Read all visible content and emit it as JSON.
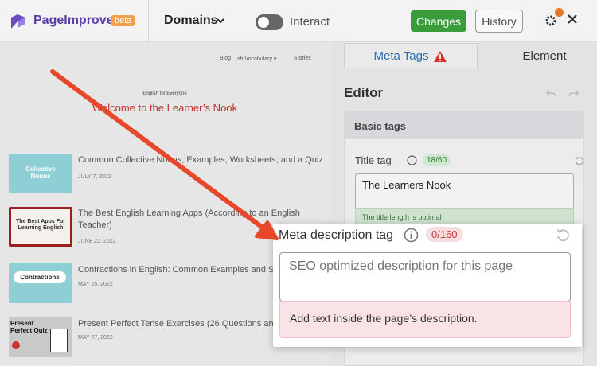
{
  "app": {
    "brand": "PageImprove",
    "beta_badge": "beta",
    "domains_label": "Domains",
    "interact_label": "Interact",
    "changes_label": "Changes",
    "history_label": "History"
  },
  "preview": {
    "nav": [
      "Blog",
      "sh Vocabulary ▾",
      "Stories"
    ],
    "kicker": "English for Everyone",
    "site_title": "Welcome to the Learner’s Nook",
    "posts": [
      {
        "title": "Common Collective Nouns, Examples, Worksheets, and a Quiz",
        "date": "JULY 7, 2022",
        "thumb_text": "Collective Nouns",
        "thumb_bg": "#8ecfd6"
      },
      {
        "title": "The Best English Learning Apps (According to an English Teacher)",
        "date": "JUNE 22, 2022",
        "thumb_text": "The Best Apps For Learning English",
        "thumb_bg": "#f4f1ec"
      },
      {
        "title": "Contractions in English: Common Examples and Sp",
        "date": "MAY 25, 2022",
        "thumb_text": "Contractions",
        "thumb_bg": "#8ecfd6"
      },
      {
        "title": "Present Perfect Tense Exercises (26 Questions and",
        "date": "MAY 27, 2022",
        "thumb_text": "Present Perfect Quiz",
        "thumb_bg": "#c9c9c9"
      }
    ]
  },
  "panel": {
    "tab_meta": "Meta Tags",
    "tab_element": "Element",
    "editor_title": "Editor",
    "basic_tags": "Basic tags",
    "title_tag_label": "Title tag",
    "title_count": "18/60",
    "title_value": "The Learners Nook",
    "title_note": "The title length is optimal"
  },
  "meta_description": {
    "label": "Meta description tag",
    "count": "0/160",
    "placeholder": "SEO optimized description for this page",
    "error": "Add text inside the page’s description."
  },
  "colors": {
    "accent_purple": "#5a3fa6",
    "changes_green": "#3a9c3a",
    "beta_orange": "#f0a04b",
    "arrow_red": "#e8472c",
    "site_title_red": "#b8332e"
  },
  "icons": [
    "logo-icon",
    "chevron-down-icon",
    "toggle-switch",
    "gear-icon",
    "notification-dot",
    "close-icon",
    "warning-icon",
    "undo-icon",
    "redo-icon",
    "info-icon",
    "reset-icon"
  ]
}
